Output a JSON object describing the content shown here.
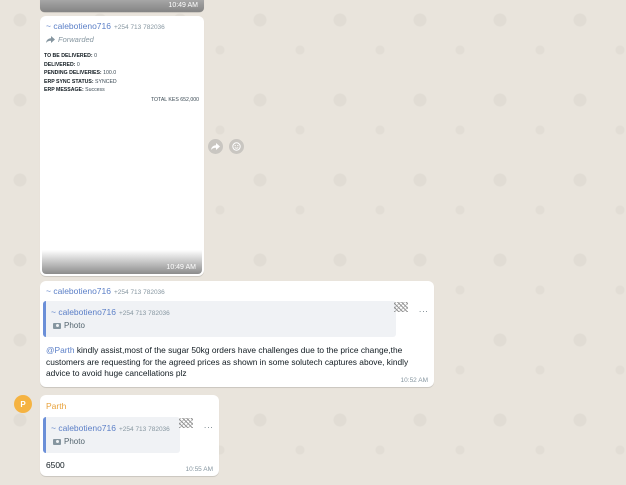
{
  "top_image": {
    "time": "10:49 AM"
  },
  "doc_message": {
    "sender": "~ calebotieno716",
    "phone": "+254 713 782036",
    "forwarded_label": "Forwarded",
    "lines": [
      {
        "key": "TO BE DELIVERED:",
        "value": "0"
      },
      {
        "key": "DELIVERED:",
        "value": "0"
      },
      {
        "key": "PENDING DELIVERIES:",
        "value": "100.0"
      },
      {
        "key": "ERP SYNC STATUS:",
        "value": "SYNCED"
      },
      {
        "key": "ERP MESSAGE:",
        "value": "Success"
      }
    ],
    "total": "TOTAL KES 652,000",
    "time": "10:49 AM"
  },
  "reply_message": {
    "sender": "~ calebotieno716",
    "phone": "+254 713 782036",
    "quote_sender": "~ calebotieno716",
    "quote_phone": "+254 713 782036",
    "quote_label": "Photo",
    "mention": "@Parth",
    "text": " kindly assist,most of the sugar 50kg orders have challenges due to the price change,the customers are requesting for the agreed prices as shown in some solutech captures above, kindly advice to avoid huge cancellations plz",
    "time": "10:52 AM"
  },
  "parth_message": {
    "avatar_letter": "P",
    "sender": "Parth",
    "quote_sender": "~ calebotieno716",
    "quote_phone": "+254 713 782036",
    "quote_label": "Photo",
    "text": "6500",
    "time": "10:55 AM"
  },
  "colors": {
    "background": "#e9e4dc",
    "mention": "#5b7fc7",
    "avatar": "#f5b342"
  },
  "icons": [
    "forward-icon",
    "camera-icon",
    "share-icon",
    "react-icon"
  ]
}
